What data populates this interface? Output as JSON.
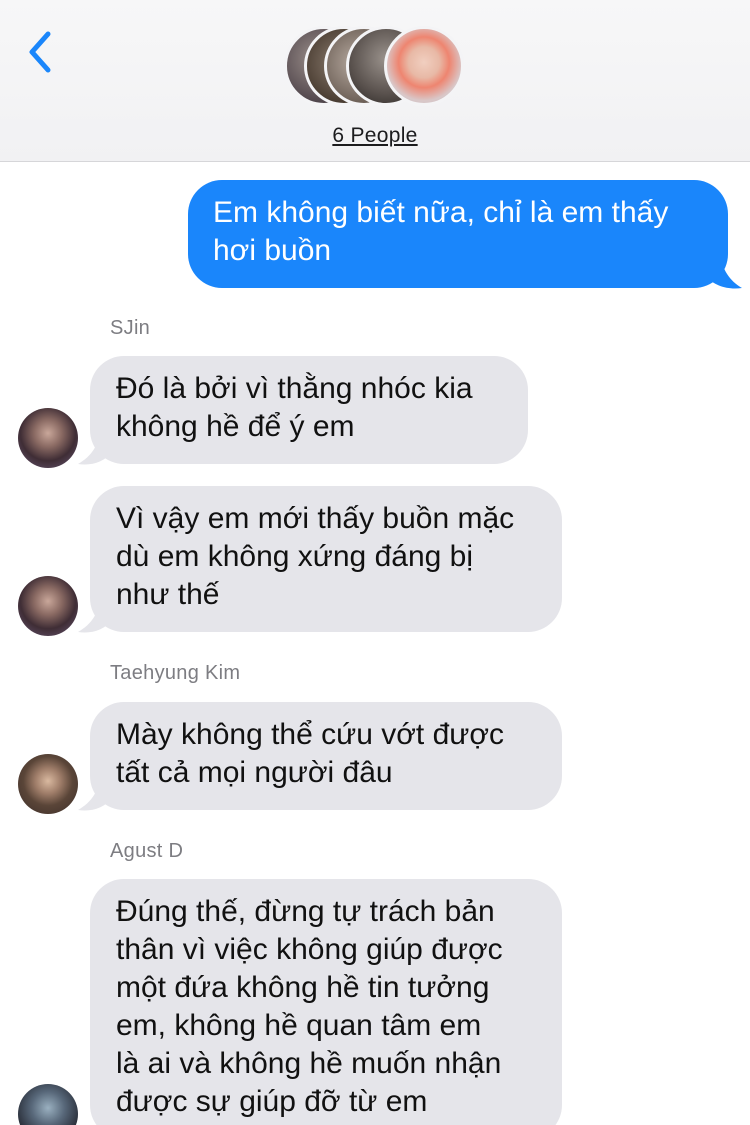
{
  "header": {
    "back_icon": "chevron-left-icon",
    "people_label": "6 People",
    "group_avatar_count": 5
  },
  "messages": [
    {
      "direction": "outgoing",
      "lines": [
        "Em không biết nữa, chỉ là em thấy",
        "hơi buồn"
      ]
    },
    {
      "sender": "SJin"
    },
    {
      "direction": "incoming",
      "lines": [
        "Đó là bởi vì thằng nhóc kia",
        "không hề để ý em"
      ]
    },
    {
      "direction": "incoming",
      "lines": [
        "Vì vậy em mới thấy buồn mặc",
        "dù em không xứng đáng bị",
        "như thế"
      ]
    },
    {
      "sender": "Taehyung Kim"
    },
    {
      "direction": "incoming",
      "lines": [
        "Mày không thể cứu vớt được",
        "tất cả mọi người đâu"
      ]
    },
    {
      "sender": "Agust D"
    },
    {
      "direction": "incoming",
      "lines": [
        "Đúng thế, đừng tự trách bản",
        "thân vì việc không giúp được",
        "một đứa không hề tin tưởng",
        "em, không hề quan tâm em",
        "là ai và không hề muốn nhận",
        "được sự giúp đỡ từ em"
      ]
    }
  ],
  "colors": {
    "outgoing_bubble": "#1a86fb",
    "incoming_bubble": "#e5e5ea",
    "accent": "#1a86fb"
  }
}
